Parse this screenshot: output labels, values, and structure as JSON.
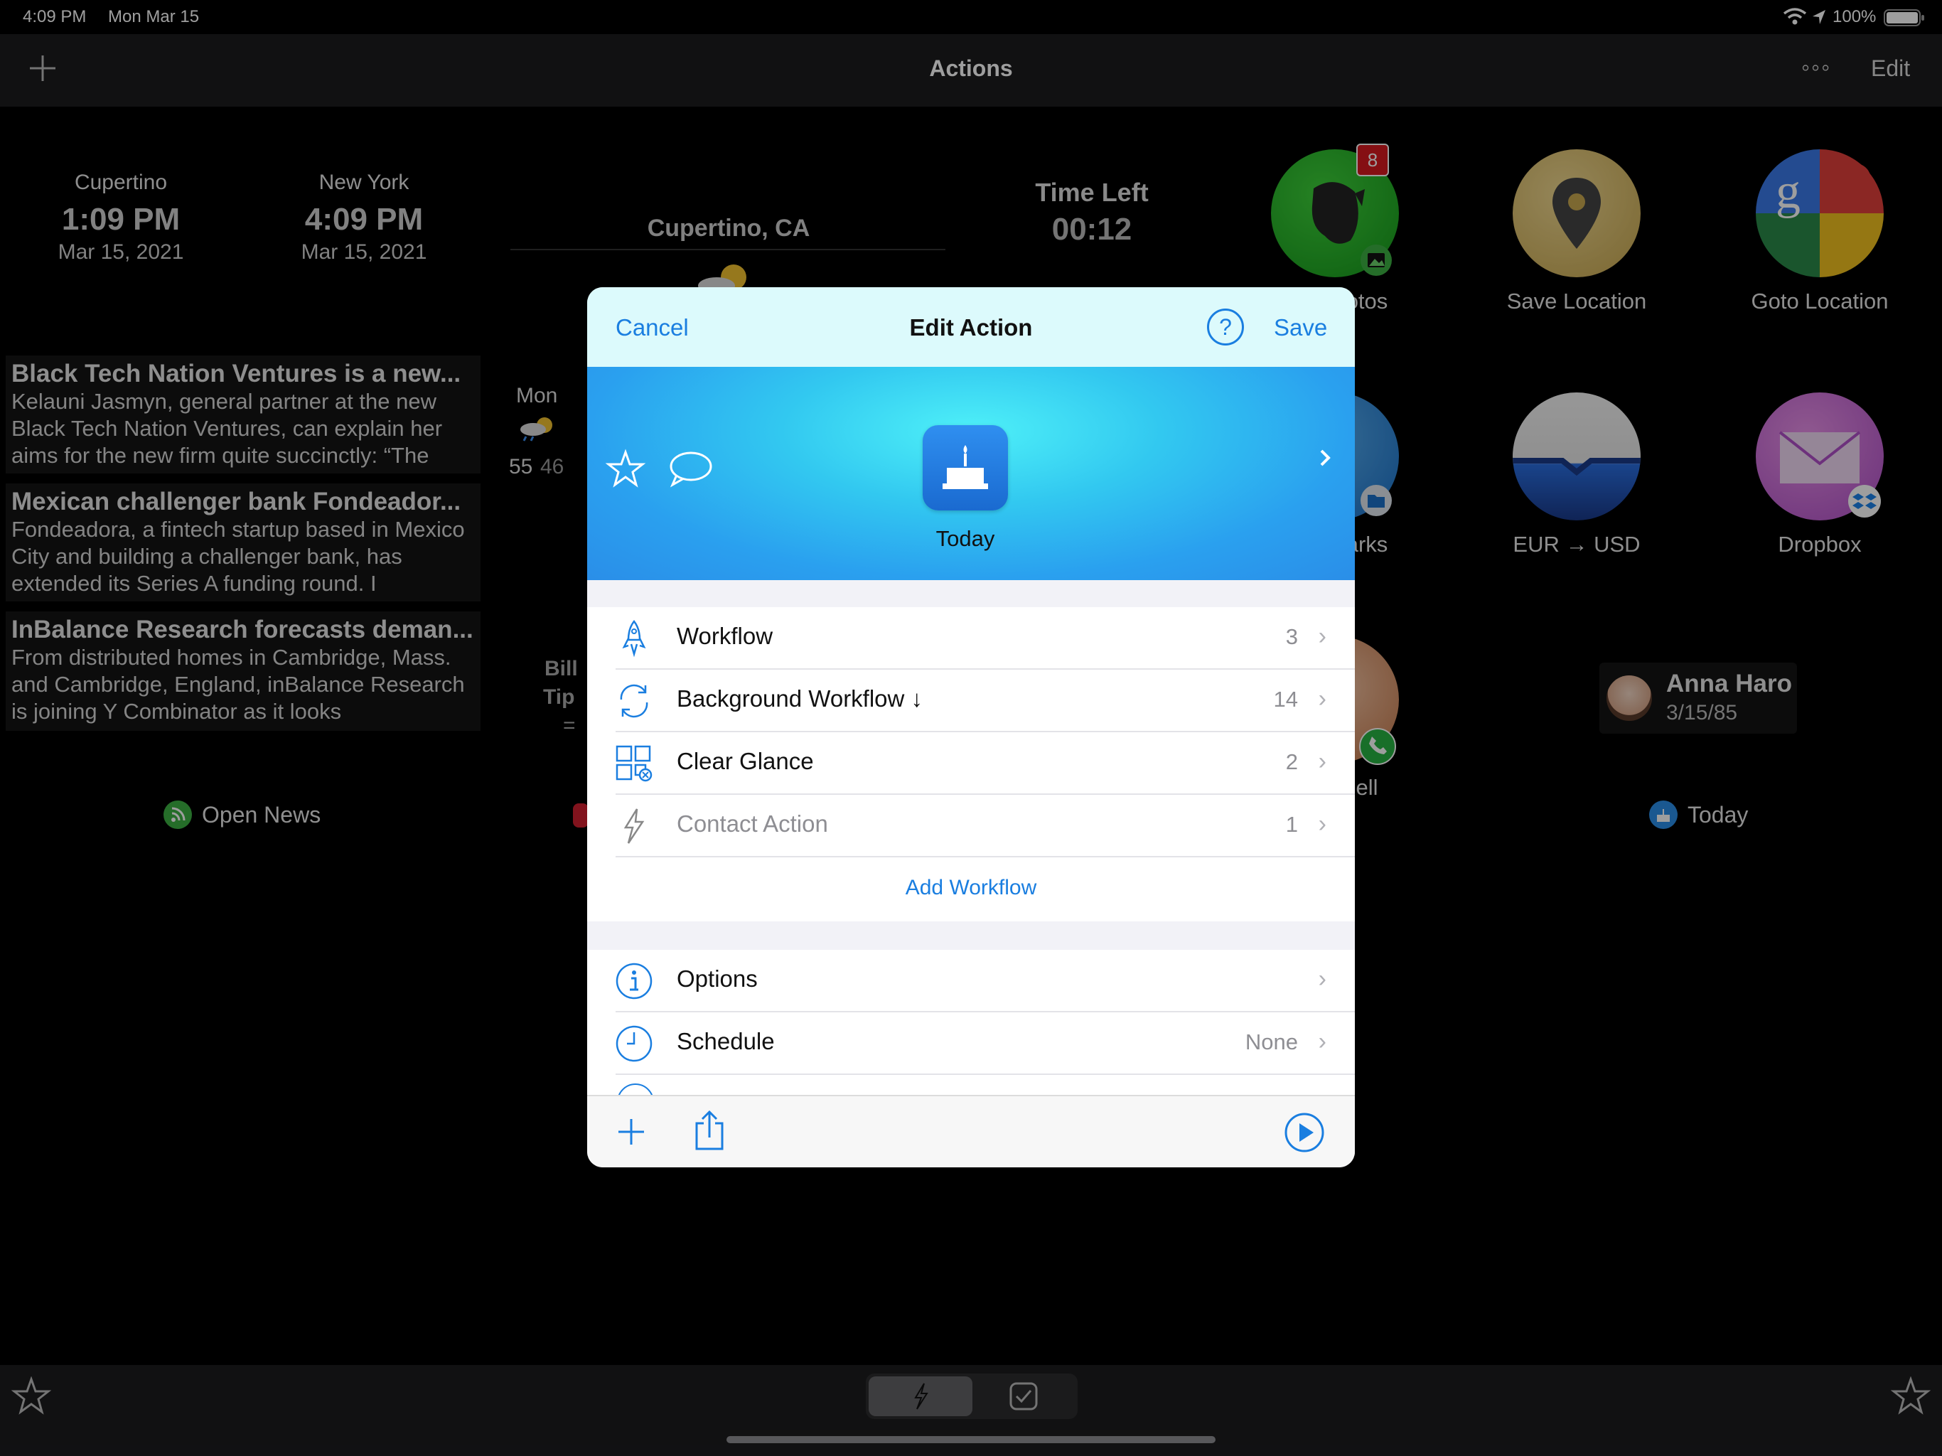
{
  "status_bar": {
    "time": "4:09 PM",
    "date": "Mon Mar 15",
    "battery": "100%"
  },
  "nav": {
    "title": "Actions",
    "add_label": "+",
    "more_label": "◦◦◦",
    "edit_label": "Edit"
  },
  "clocks": [
    {
      "city": "Cupertino",
      "time": "1:09 PM",
      "date": "Mar 15, 2021"
    },
    {
      "city": "New York",
      "time": "4:09 PM",
      "date": "Mar 15, 2021"
    }
  ],
  "weather": {
    "location": "Cupertino, CA",
    "day": "Mon",
    "high": "55",
    "low": "46"
  },
  "timer": {
    "label": "Time Left",
    "value": "00:12"
  },
  "news": [
    {
      "title": "Black Tech Nation Ventures is a new...",
      "body": "Kelauni Jasmyn, general partner at the new Black Tech Nation Ventures, can explain her aims for the new firm quite succinctly: “The"
    },
    {
      "title": "Mexican challenger bank Fondeador...",
      "body": "Fondeadora, a fintech startup based in Mexico City and building a challenger bank, has extended its Series A funding round. I"
    },
    {
      "title": "InBalance Research forecasts deman...",
      "body": "From distributed homes in Cambridge, Mass. and Cambridge, England, inBalance Research is joining Y Combinator as it looks"
    }
  ],
  "open_news_label": "Open News",
  "bill_tip": {
    "line1": "Bill",
    "line2": "Tip",
    "line3": "="
  },
  "apps": {
    "photos": {
      "label": "otos",
      "badge": "8"
    },
    "save_location": {
      "label": "Save Location"
    },
    "goto_location": {
      "label": "Goto Location"
    },
    "bookmarks": {
      "label": "arks"
    },
    "eur_usd": {
      "label": "EUR → USD"
    },
    "dropbox": {
      "label": "Dropbox"
    },
    "contact_call": {
      "label": "ell"
    }
  },
  "contact": {
    "name": "Anna Haro",
    "date": "3/15/85"
  },
  "today_label": "Today",
  "modal": {
    "cancel_label": "Cancel",
    "title": "Edit Action",
    "help_label": "?",
    "save_label": "Save",
    "action_name": "Today",
    "rows": [
      {
        "label": "Workflow",
        "value": "3"
      },
      {
        "label": "Background Workflow ↓",
        "value": "14"
      },
      {
        "label": "Clear Glance",
        "value": "2"
      },
      {
        "label": "Contact Action",
        "value": "1"
      }
    ],
    "add_workflow_label": "Add Workflow",
    "options_label": "Options",
    "schedule_label": "Schedule",
    "schedule_value": "None"
  },
  "colors": {
    "accent": "#1a7ee0",
    "hero_start": "#4ef0f8",
    "hero_end": "#2a8ee8"
  }
}
